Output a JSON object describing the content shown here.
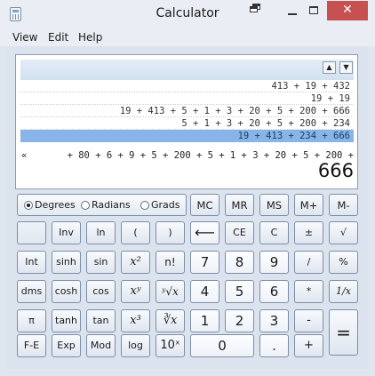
{
  "window": {
    "title": "Calculator",
    "close_glyph": "✕"
  },
  "menu": [
    "View",
    "Edit",
    "Help"
  ],
  "history_scroll": {
    "up": "▲",
    "down": "▼"
  },
  "history": [
    "413 + 19 + 432",
    "19 + 19",
    "19 + 413 + 5 + 1 + 3 + 20 + 5 + 200 + 666",
    "5 + 1 + 3 + 20 + 5 + 200 + 234",
    "19 + 413 + 234 + 666"
  ],
  "expression": {
    "scroll_left": "«",
    "text": "+ 80 + 6 + 9 + 5 + 200 + 5 + 1 + 3 + 20 + 5 + 200 +"
  },
  "result": "666",
  "angle_units": {
    "options": [
      "Degrees",
      "Radians",
      "Grads"
    ],
    "selected": "Degrees"
  },
  "memory_buttons": [
    "MC",
    "MR",
    "MS",
    "M+",
    "M-"
  ],
  "row2": [
    "",
    "Inv",
    "ln",
    "(",
    ")",
    "⟵",
    "CE",
    "C",
    "±",
    "√"
  ],
  "row3": [
    "Int",
    "sinh",
    "sin",
    "x²",
    "n!",
    "7",
    "8",
    "9",
    "/",
    "%"
  ],
  "row4": [
    "dms",
    "cosh",
    "cos",
    "xʸ",
    "ʸ√x",
    "4",
    "5",
    "6",
    "*",
    "1/x"
  ],
  "row5": [
    "π",
    "tanh",
    "tan",
    "x³",
    "∛x",
    "1",
    "2",
    "3",
    "-",
    "="
  ],
  "row6": [
    "F-E",
    "Exp",
    "Mod",
    "log",
    "10ˣ",
    "0",
    ".",
    "+"
  ],
  "colors": {
    "accent_selected": "#89b4e8",
    "close_button": "#c75050"
  }
}
